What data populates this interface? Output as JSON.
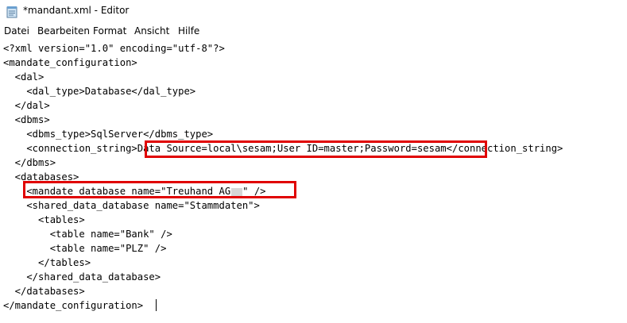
{
  "window": {
    "title": "*mandant.xml - Editor",
    "icon": "notepad-icon"
  },
  "menu": {
    "items": [
      "Datei",
      "Bearbeiten",
      "Format",
      "Ansicht",
      "Hilfe"
    ]
  },
  "editor": {
    "lines": [
      "<?xml version=\"1.0\" encoding=\"utf-8\"?>",
      "<mandate_configuration>",
      "  <dal>",
      "    <dal_type>Database</dal_type>",
      "  </dal>",
      "  <dbms>",
      "    <dbms_type>SqlServer</dbms_type>",
      "    <connection_string>Data Source=local\\sesam;User ID=master;Password=sesam</connection_string>",
      "  </dbms>",
      "  <databases>",
      "    <mandate_database name=\"Treuhand AG",
      "    <shared_data_database name=\"Stammdaten\">",
      "      <tables>",
      "        <table name=\"Bank\" />",
      "        <table name=\"PLZ\" />",
      "      </tables>",
      "    </shared_data_database>",
      "  </databases>",
      "</mandate_configuration>"
    ],
    "line10_suffix": "\" />"
  },
  "colors": {
    "highlight": "#e00000"
  }
}
